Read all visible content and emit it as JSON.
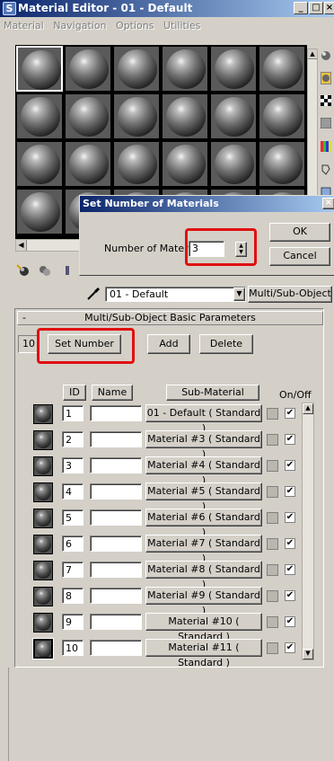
{
  "window": {
    "title": "Material Editor - 01 - Default",
    "app_icon": "3ds-max-icon",
    "controls": [
      "minimize",
      "maximize",
      "close"
    ]
  },
  "menu": [
    "Material",
    "Navigation",
    "Options",
    "Utilities"
  ],
  "dialog": {
    "title": "Set Number of Materials",
    "label": "Number of Materials:",
    "value": "3",
    "ok_label": "OK",
    "cancel_label": "Cancel"
  },
  "type_row": {
    "material_name": "01 - Default",
    "material_type": "Multi/Sub-Object"
  },
  "rollout": {
    "title": "Multi/Sub-Object Basic Parameters",
    "count": "10",
    "set_number_label": "Set Number",
    "add_label": "Add",
    "delete_label": "Delete",
    "columns": {
      "id": "ID",
      "name": "Name",
      "sub_material": "Sub-Material",
      "on_off": "On/Off"
    },
    "rows": [
      {
        "id": "1",
        "name": "",
        "material": "01 - Default  ( Standard )",
        "on": true
      },
      {
        "id": "2",
        "name": "",
        "material": "Material #3  ( Standard )",
        "on": true
      },
      {
        "id": "3",
        "name": "",
        "material": "Material #4  ( Standard )",
        "on": true
      },
      {
        "id": "4",
        "name": "",
        "material": "Material #5  ( Standard )",
        "on": true
      },
      {
        "id": "5",
        "name": "",
        "material": "Material #6  ( Standard )",
        "on": true
      },
      {
        "id": "6",
        "name": "",
        "material": "Material #7  ( Standard )",
        "on": true
      },
      {
        "id": "7",
        "name": "",
        "material": "Material #8  ( Standard )",
        "on": true
      },
      {
        "id": "8",
        "name": "",
        "material": "Material #9  ( Standard )",
        "on": true
      },
      {
        "id": "9",
        "name": "",
        "material": "Material #10  ( Standard )",
        "on": true
      },
      {
        "id": "10",
        "name": "",
        "material": "Material #11  ( Standard )",
        "on": true
      }
    ]
  },
  "colors": {
    "highlight": "#e01010",
    "title_bar": "#0a246a"
  }
}
